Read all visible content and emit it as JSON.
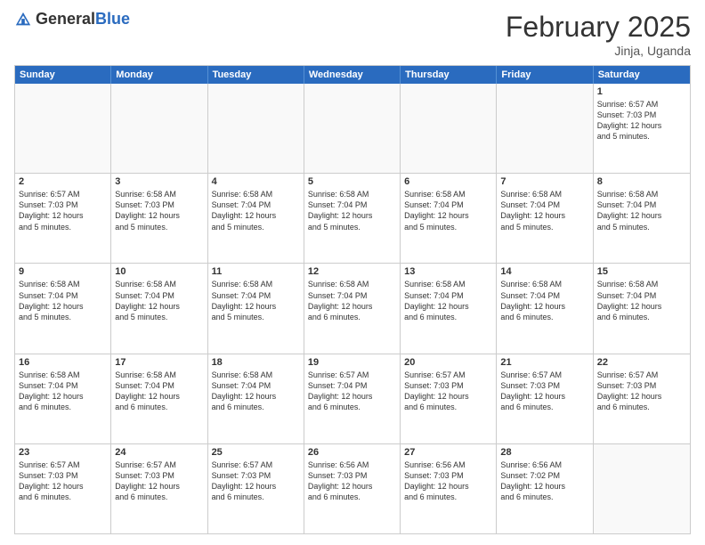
{
  "header": {
    "logo_general": "General",
    "logo_blue": "Blue",
    "month_title": "February 2025",
    "location": "Jinja, Uganda"
  },
  "calendar": {
    "days": [
      "Sunday",
      "Monday",
      "Tuesday",
      "Wednesday",
      "Thursday",
      "Friday",
      "Saturday"
    ],
    "rows": [
      [
        {
          "day": "",
          "text": "",
          "empty": true
        },
        {
          "day": "",
          "text": "",
          "empty": true
        },
        {
          "day": "",
          "text": "",
          "empty": true
        },
        {
          "day": "",
          "text": "",
          "empty": true
        },
        {
          "day": "",
          "text": "",
          "empty": true
        },
        {
          "day": "",
          "text": "",
          "empty": true
        },
        {
          "day": "1",
          "text": "Sunrise: 6:57 AM\nSunset: 7:03 PM\nDaylight: 12 hours\nand 5 minutes.",
          "empty": false
        }
      ],
      [
        {
          "day": "2",
          "text": "Sunrise: 6:57 AM\nSunset: 7:03 PM\nDaylight: 12 hours\nand 5 minutes.",
          "empty": false
        },
        {
          "day": "3",
          "text": "Sunrise: 6:58 AM\nSunset: 7:03 PM\nDaylight: 12 hours\nand 5 minutes.",
          "empty": false
        },
        {
          "day": "4",
          "text": "Sunrise: 6:58 AM\nSunset: 7:04 PM\nDaylight: 12 hours\nand 5 minutes.",
          "empty": false
        },
        {
          "day": "5",
          "text": "Sunrise: 6:58 AM\nSunset: 7:04 PM\nDaylight: 12 hours\nand 5 minutes.",
          "empty": false
        },
        {
          "day": "6",
          "text": "Sunrise: 6:58 AM\nSunset: 7:04 PM\nDaylight: 12 hours\nand 5 minutes.",
          "empty": false
        },
        {
          "day": "7",
          "text": "Sunrise: 6:58 AM\nSunset: 7:04 PM\nDaylight: 12 hours\nand 5 minutes.",
          "empty": false
        },
        {
          "day": "8",
          "text": "Sunrise: 6:58 AM\nSunset: 7:04 PM\nDaylight: 12 hours\nand 5 minutes.",
          "empty": false
        }
      ],
      [
        {
          "day": "9",
          "text": "Sunrise: 6:58 AM\nSunset: 7:04 PM\nDaylight: 12 hours\nand 5 minutes.",
          "empty": false
        },
        {
          "day": "10",
          "text": "Sunrise: 6:58 AM\nSunset: 7:04 PM\nDaylight: 12 hours\nand 5 minutes.",
          "empty": false
        },
        {
          "day": "11",
          "text": "Sunrise: 6:58 AM\nSunset: 7:04 PM\nDaylight: 12 hours\nand 5 minutes.",
          "empty": false
        },
        {
          "day": "12",
          "text": "Sunrise: 6:58 AM\nSunset: 7:04 PM\nDaylight: 12 hours\nand 6 minutes.",
          "empty": false
        },
        {
          "day": "13",
          "text": "Sunrise: 6:58 AM\nSunset: 7:04 PM\nDaylight: 12 hours\nand 6 minutes.",
          "empty": false
        },
        {
          "day": "14",
          "text": "Sunrise: 6:58 AM\nSunset: 7:04 PM\nDaylight: 12 hours\nand 6 minutes.",
          "empty": false
        },
        {
          "day": "15",
          "text": "Sunrise: 6:58 AM\nSunset: 7:04 PM\nDaylight: 12 hours\nand 6 minutes.",
          "empty": false
        }
      ],
      [
        {
          "day": "16",
          "text": "Sunrise: 6:58 AM\nSunset: 7:04 PM\nDaylight: 12 hours\nand 6 minutes.",
          "empty": false
        },
        {
          "day": "17",
          "text": "Sunrise: 6:58 AM\nSunset: 7:04 PM\nDaylight: 12 hours\nand 6 minutes.",
          "empty": false
        },
        {
          "day": "18",
          "text": "Sunrise: 6:58 AM\nSunset: 7:04 PM\nDaylight: 12 hours\nand 6 minutes.",
          "empty": false
        },
        {
          "day": "19",
          "text": "Sunrise: 6:57 AM\nSunset: 7:04 PM\nDaylight: 12 hours\nand 6 minutes.",
          "empty": false
        },
        {
          "day": "20",
          "text": "Sunrise: 6:57 AM\nSunset: 7:03 PM\nDaylight: 12 hours\nand 6 minutes.",
          "empty": false
        },
        {
          "day": "21",
          "text": "Sunrise: 6:57 AM\nSunset: 7:03 PM\nDaylight: 12 hours\nand 6 minutes.",
          "empty": false
        },
        {
          "day": "22",
          "text": "Sunrise: 6:57 AM\nSunset: 7:03 PM\nDaylight: 12 hours\nand 6 minutes.",
          "empty": false
        }
      ],
      [
        {
          "day": "23",
          "text": "Sunrise: 6:57 AM\nSunset: 7:03 PM\nDaylight: 12 hours\nand 6 minutes.",
          "empty": false
        },
        {
          "day": "24",
          "text": "Sunrise: 6:57 AM\nSunset: 7:03 PM\nDaylight: 12 hours\nand 6 minutes.",
          "empty": false
        },
        {
          "day": "25",
          "text": "Sunrise: 6:57 AM\nSunset: 7:03 PM\nDaylight: 12 hours\nand 6 minutes.",
          "empty": false
        },
        {
          "day": "26",
          "text": "Sunrise: 6:56 AM\nSunset: 7:03 PM\nDaylight: 12 hours\nand 6 minutes.",
          "empty": false
        },
        {
          "day": "27",
          "text": "Sunrise: 6:56 AM\nSunset: 7:03 PM\nDaylight: 12 hours\nand 6 minutes.",
          "empty": false
        },
        {
          "day": "28",
          "text": "Sunrise: 6:56 AM\nSunset: 7:02 PM\nDaylight: 12 hours\nand 6 minutes.",
          "empty": false
        },
        {
          "day": "",
          "text": "",
          "empty": true
        }
      ]
    ]
  }
}
